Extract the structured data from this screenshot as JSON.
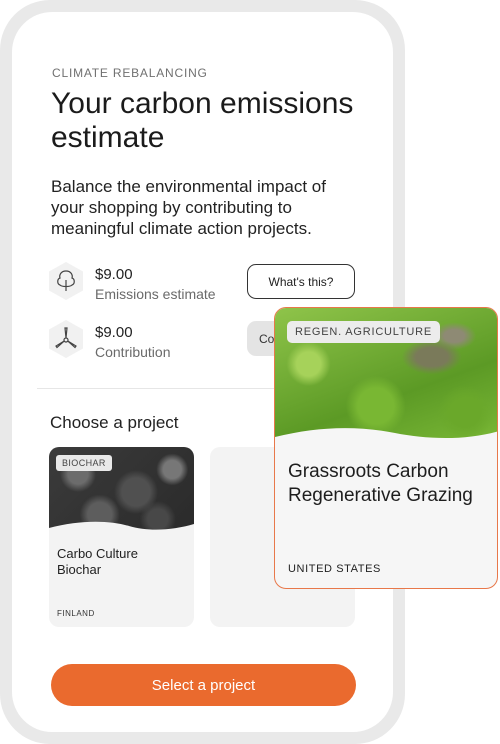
{
  "header": {
    "eyebrow": "CLIMATE REBALANCING",
    "title": "Your carbon emissions estimate",
    "description": "Balance the environmental impact of your shopping by contributing to meaningful climate action projects."
  },
  "stats": [
    {
      "value": "$9.00",
      "label": "Emissions estimate",
      "icon": "tree-icon"
    },
    {
      "value": "$9.00",
      "label": "Contribution",
      "icon": "wind-turbine-icon"
    }
  ],
  "buttons": {
    "whats_this": "What's this?",
    "contribute_partial": "Co",
    "cta": "Select a project"
  },
  "projects": {
    "section_title": "Choose a project",
    "cards": [
      {
        "tag": "BIOCHAR",
        "title": "Carbo Culture Biochar",
        "country": "FINLAND"
      }
    ]
  },
  "popup": {
    "tag": "REGEN. AGRICULTURE",
    "title": "Grassroots Carbon Regenerative Grazing",
    "country": "UNITED STATES"
  },
  "colors": {
    "accent": "#ea6a2e",
    "popup_border": "#e8784a"
  }
}
